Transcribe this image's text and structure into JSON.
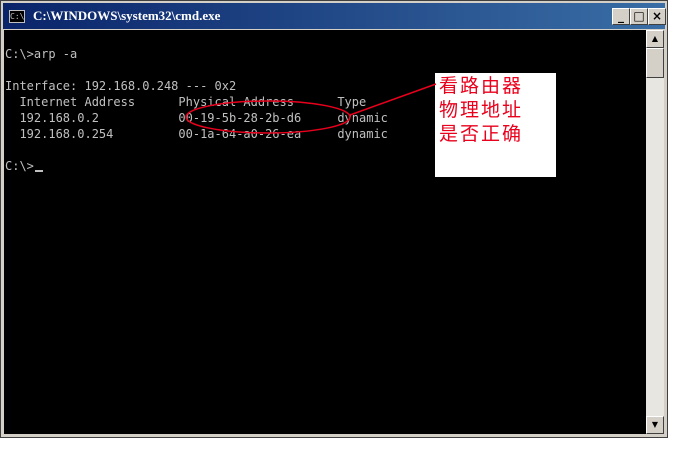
{
  "window": {
    "title": "C:\\WINDOWS\\system32\\cmd.exe",
    "icon_text": "C:\\",
    "buttons": {
      "minimize": "_",
      "maximize": "□",
      "close": "×"
    }
  },
  "console": {
    "lines": [
      "C:\\>arp -a",
      "",
      "Interface: 192.168.0.248 --- 0x2",
      "  Internet Address      Physical Address      Type",
      "  192.168.0.2           00-19-5b-28-2b-d6     dynamic",
      "  192.168.0.254         00-1a-64-a0-26-ea     dynamic",
      "",
      "C:\\>"
    ]
  },
  "annotation": {
    "lines": [
      "看路由器",
      "物理地址",
      "是否正确"
    ],
    "color": "#e8001c"
  },
  "scrollbar": {
    "up": "▲",
    "down": "▼"
  },
  "colors": {
    "console_bg": "#000000",
    "console_text": "#c0c0c0",
    "title_start": "#0a246a",
    "title_end": "#3a6ea5"
  }
}
